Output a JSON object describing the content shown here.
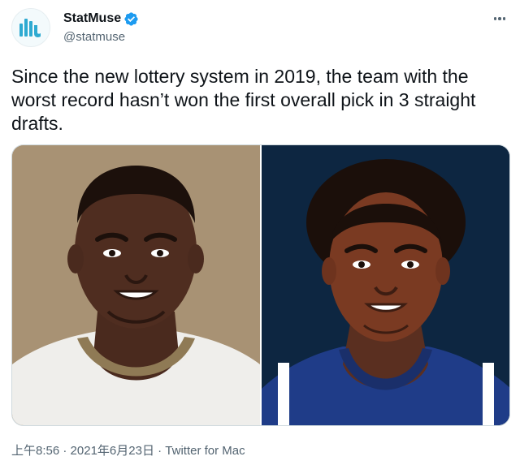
{
  "account": {
    "display_name": "StatMuse",
    "handle": "@statmuse",
    "verified": true
  },
  "tweet": {
    "text": "Since the new lottery system in 2019, the team with the worst record hasn’t won the first overall pick in 3 straight drafts."
  },
  "meta": {
    "time": "上午8:56",
    "separator1": " · ",
    "date": "2021年6月23日",
    "separator2": " · ",
    "source": "Twitter for Mac"
  },
  "colors": {
    "text": "#0f1419",
    "secondary": "#536471",
    "verified_blue": "#1d9bf0",
    "brand_teal": "#2eaad1",
    "left_panel_bg": "#a89274",
    "right_panel_bg": "#0d2641"
  },
  "icons": {
    "avatar": "statmuse-logo-icon",
    "verified": "verified-badge-icon",
    "more": "more-options-icon"
  }
}
